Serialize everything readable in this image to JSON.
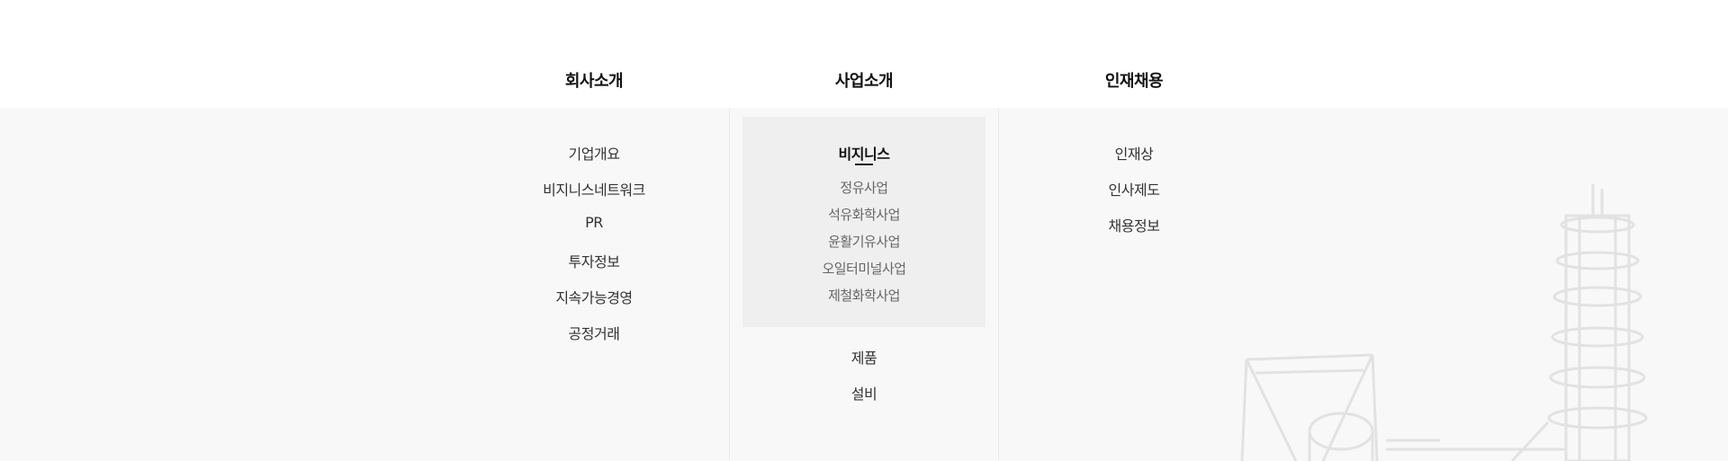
{
  "header": {
    "columns": [
      {
        "title": "회사소개"
      },
      {
        "title": "사업소개"
      },
      {
        "title": "인재채용"
      }
    ]
  },
  "company": {
    "items": [
      "기업개요",
      "비지니스네트워크",
      "PR",
      "투자정보",
      "지속가능경영",
      "공정거래"
    ]
  },
  "business": {
    "active_sub": "비지니스",
    "sub_items": [
      "정유사업",
      "석유화학사업",
      "윤활기유사업",
      "오일터미널사업",
      "제철화학사업"
    ],
    "items": [
      "제품",
      "설비"
    ]
  },
  "recruit": {
    "items": [
      "인재상",
      "인사제도",
      "채용정보"
    ]
  },
  "theme": {
    "panel_bg": "#f8f8f8",
    "highlight_bg": "#efefef",
    "text_dark": "#111111",
    "text_sub": "#666666"
  },
  "icons": {
    "background": "refinery-illustration"
  }
}
